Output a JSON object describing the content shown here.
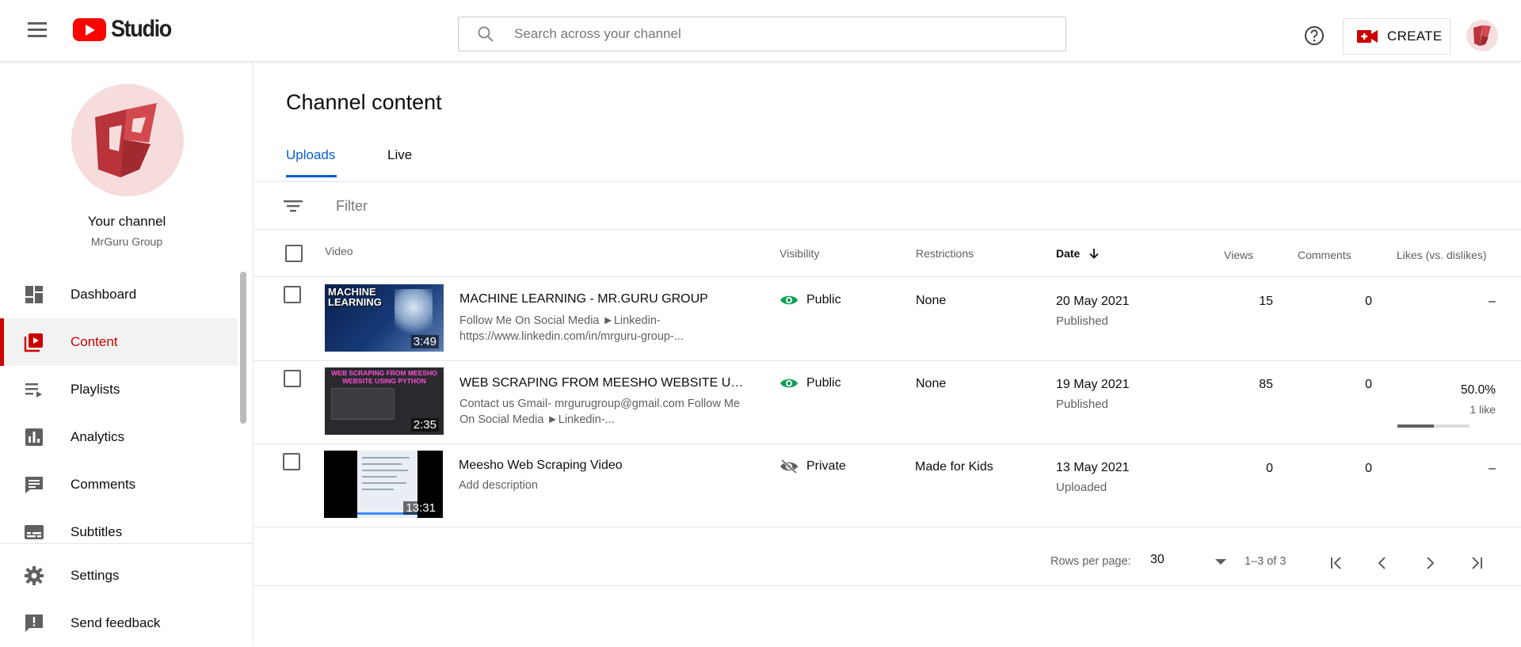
{
  "header": {
    "logo_text": "Studio",
    "search_placeholder": "Search across your channel",
    "create_label": "CREATE"
  },
  "sidebar": {
    "channel_title": "Your channel",
    "channel_name": "MrGuru Group",
    "items": [
      {
        "label": "Dashboard",
        "icon": "dashboard-icon"
      },
      {
        "label": "Content",
        "icon": "content-icon",
        "active": true
      },
      {
        "label": "Playlists",
        "icon": "playlists-icon"
      },
      {
        "label": "Analytics",
        "icon": "analytics-icon"
      },
      {
        "label": "Comments",
        "icon": "comments-icon"
      },
      {
        "label": "Subtitles",
        "icon": "subtitles-icon"
      }
    ],
    "bottom_items": [
      {
        "label": "Settings",
        "icon": "gear-icon"
      },
      {
        "label": "Send feedback",
        "icon": "feedback-icon"
      }
    ]
  },
  "main": {
    "title": "Channel content",
    "tabs": [
      {
        "label": "Uploads",
        "active": true
      },
      {
        "label": "Live",
        "active": false
      }
    ],
    "filter_placeholder": "Filter",
    "columns": {
      "video": "Video",
      "visibility": "Visibility",
      "restrictions": "Restrictions",
      "date": "Date",
      "views": "Views",
      "comments": "Comments",
      "likes": "Likes (vs. dislikes)"
    },
    "rows": [
      {
        "title": "MACHINE LEARNING - MR.GURU GROUP",
        "description": "Follow Me On Social Media ►Linkedin- https://www.linkedin.com/in/mrguru-group-...",
        "duration": "3:49",
        "thumb_text": "MACHINE LEARNING",
        "visibility": "Public",
        "restrictions": "None",
        "date": "20 May 2021",
        "date_status": "Published",
        "views": "15",
        "comments": "0",
        "likes": "–",
        "likes_sub": "",
        "likes_ratio": null
      },
      {
        "title": "WEB SCRAPING FROM MEESHO WEBSITE USI...",
        "description": "Contact us Gmail- mrgurugroup@gmail.com Follow Me On Social Media ►Linkedin-...",
        "duration": "2:35",
        "thumb_text": "WEB SCRAPING FROM MEESHO WEBSITE USING PYTHON",
        "visibility": "Public",
        "restrictions": "None",
        "date": "19 May 2021",
        "date_status": "Published",
        "views": "85",
        "comments": "0",
        "likes": "50.0%",
        "likes_sub": "1 like",
        "likes_ratio": 0.5
      },
      {
        "title": "Meesho Web Scraping Video",
        "description": "Add description",
        "duration": "13:31",
        "thumb_text": "",
        "visibility": "Private",
        "restrictions": "Made for Kids",
        "date": "13 May 2021",
        "date_status": "Uploaded",
        "views": "0",
        "comments": "0",
        "likes": "–",
        "likes_sub": "",
        "likes_ratio": null
      }
    ],
    "pagination": {
      "rows_per_page_label": "Rows per page:",
      "rows_per_page_value": "30",
      "range": "1–3 of 3"
    }
  },
  "colors": {
    "brand_red": "#ff0000",
    "active_red": "#cc0000",
    "accent_blue": "#065fd4",
    "public_green": "#0f9d58"
  }
}
